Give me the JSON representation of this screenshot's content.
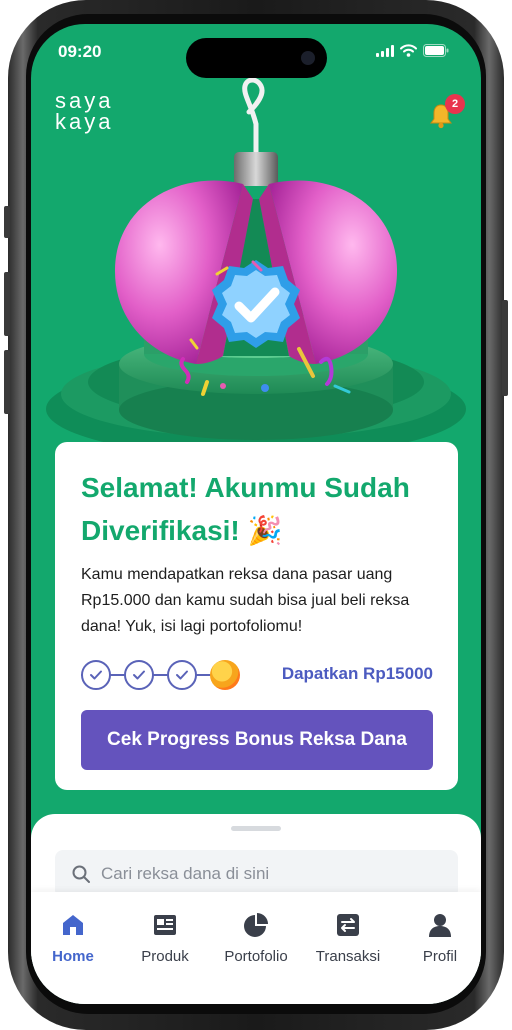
{
  "status_bar": {
    "time": "09:20"
  },
  "header": {
    "logo_line1": "saya",
    "logo_line2": "kaya",
    "notification_count": "2"
  },
  "card": {
    "title": "Selamat! Akunmu Sudah Diverifikasi! 🎉",
    "description": "Kamu mendapatkan reksa dana pasar uang Rp15.000 dan kamu sudah bisa jual beli reksa dana! Yuk, isi lagi portofoliomu!",
    "progress": {
      "completed_steps": 3,
      "total_steps": 4
    },
    "bonus_link": "Dapatkan Rp15000",
    "cta_label": "Cek Progress Bonus Reksa Dana"
  },
  "search": {
    "placeholder": "Cari reksa dana di sini"
  },
  "tabs": [
    {
      "label": "Home",
      "icon": "home-icon",
      "active": true
    },
    {
      "label": "Produk",
      "icon": "product-icon",
      "active": false
    },
    {
      "label": "Portofolio",
      "icon": "pie-chart-icon",
      "active": false
    },
    {
      "label": "Transaksi",
      "icon": "transfer-icon",
      "active": false
    },
    {
      "label": "Profil",
      "icon": "profile-icon",
      "active": false
    }
  ],
  "colors": {
    "brand_green": "#13a86d",
    "accent_purple": "#6453bd",
    "link_blue": "#4c5bc0",
    "badge_red": "#e8344e"
  }
}
